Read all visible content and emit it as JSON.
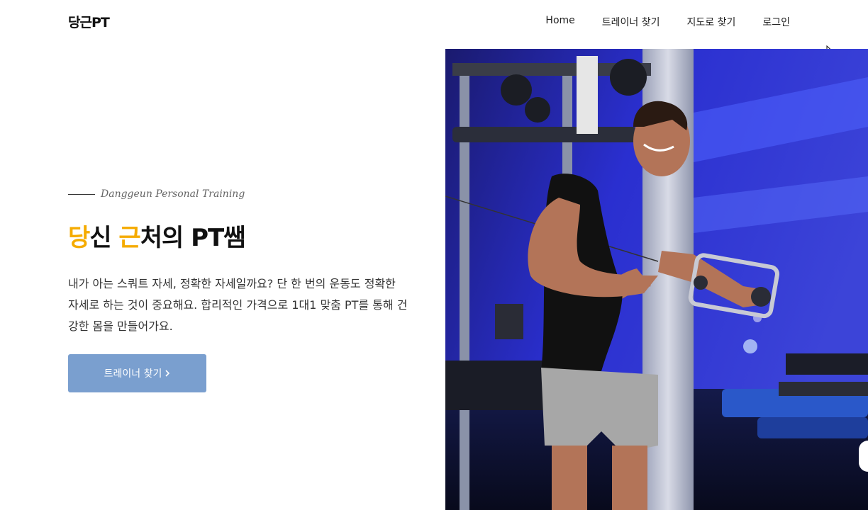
{
  "header": {
    "logo": "당근PT",
    "nav": {
      "home": "Home",
      "find_trainer": "트레이너 찾기",
      "map": "지도로 찾기",
      "login": "로그인"
    }
  },
  "hero": {
    "eyebrow": "Danggeun Personal Training",
    "headline": {
      "part1": "당",
      "part2": "신 ",
      "part3": "근",
      "part4": "처의 PT쌤"
    },
    "description": "내가 아는 스쿼트 자세, 정확한 자세일까요? 단 한 번의 운동도 정확한 자세로 하는 것이 중요해요. 합리적인 가격으로 1대1 맞춤 PT를 통해 건강한 몸을 만들어가요.",
    "cta_label": "트레이너 찾기",
    "cta_icon": "chevron-right-icon"
  },
  "colors": {
    "accent": "#f5ab00",
    "button": "#7a9fcf"
  }
}
